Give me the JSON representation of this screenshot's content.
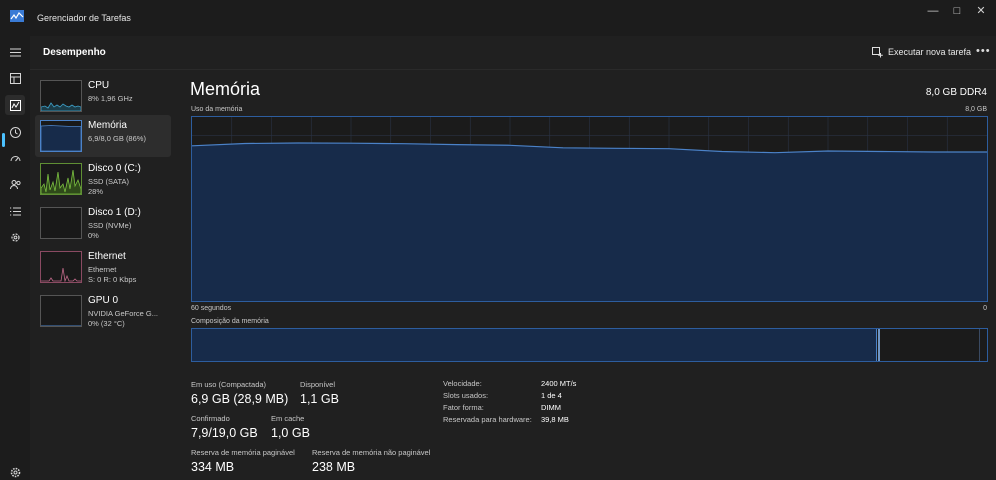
{
  "window": {
    "title": "Gerenciador de Tarefas",
    "controls": {
      "minimize": "—",
      "maximize": "□",
      "close": "✕"
    }
  },
  "header": {
    "title": "Desempenho",
    "run_task_label": "Executar nova tarefa",
    "more_label": "•••"
  },
  "sidebar": {
    "items": [
      {
        "name": "CPU",
        "line1": "8%  1,96 GHz",
        "line2": "",
        "color": "#3ea1c9"
      },
      {
        "name": "Memória",
        "line1": "6,9/8,0 GB (86%)",
        "line2": "",
        "color": "#4b82c8"
      },
      {
        "name": "Disco 0 (C:)",
        "line1": "SSD (SATA)",
        "line2": "28%",
        "color": "#7cc242"
      },
      {
        "name": "Disco 1 (D:)",
        "line1": "SSD (NVMe)",
        "line2": "0%",
        "color": "#7cc242"
      },
      {
        "name": "Ethernet",
        "line1": "Ethernet",
        "line2": "S: 0  R: 0 Kbps",
        "color": "#c16a8a"
      },
      {
        "name": "GPU 0",
        "line1": "NVIDIA GeForce G...",
        "line2": "0% (32 °C)",
        "color": "#4b82c8"
      }
    ]
  },
  "main": {
    "title": "Memória",
    "spec": "8,0 GB DDR4",
    "graph": {
      "label": "Uso da memória",
      "max_label": "8,0 GB",
      "time_label": "60 segundos",
      "zero_label": "0"
    },
    "composition": {
      "label": "Composição da memória",
      "in_use_fraction": 0.86
    },
    "stats": {
      "in_use_label": "Em uso (Compactada)",
      "in_use_value": "6,9 GB (28,9 MB)",
      "available_label": "Disponível",
      "available_value": "1,1 GB",
      "committed_label": "Confirmado",
      "committed_value": "7,9/19,0 GB",
      "cached_label": "Em cache",
      "cached_value": "1,0 GB",
      "paged_label": "Reserva de memória paginável",
      "paged_value": "334 MB",
      "nonpaged_label": "Reserva de memória não paginável",
      "nonpaged_value": "238 MB"
    },
    "details": [
      {
        "key": "Velocidade:",
        "value": "2400 MT/s"
      },
      {
        "key": "Slots usados:",
        "value": "1 de 4"
      },
      {
        "key": "Fator forma:",
        "value": "DIMM"
      },
      {
        "key": "Reservada para hardware:",
        "value": "39,8 MB"
      }
    ]
  },
  "chart_data": {
    "type": "area",
    "xlabel": "60 segundos",
    "ylabel": "Uso da memória",
    "ylim": [
      0,
      8.0
    ],
    "x": [
      60,
      56,
      52,
      48,
      44,
      40,
      36,
      32,
      28,
      24,
      20,
      16,
      12,
      8,
      4,
      0
    ],
    "values": [
      6.75,
      6.85,
      6.87,
      6.86,
      6.84,
      6.8,
      6.77,
      6.66,
      6.64,
      6.62,
      6.5,
      6.45,
      6.52,
      6.5,
      6.48,
      6.48
    ],
    "grid": true,
    "color": "#4b82c8"
  }
}
